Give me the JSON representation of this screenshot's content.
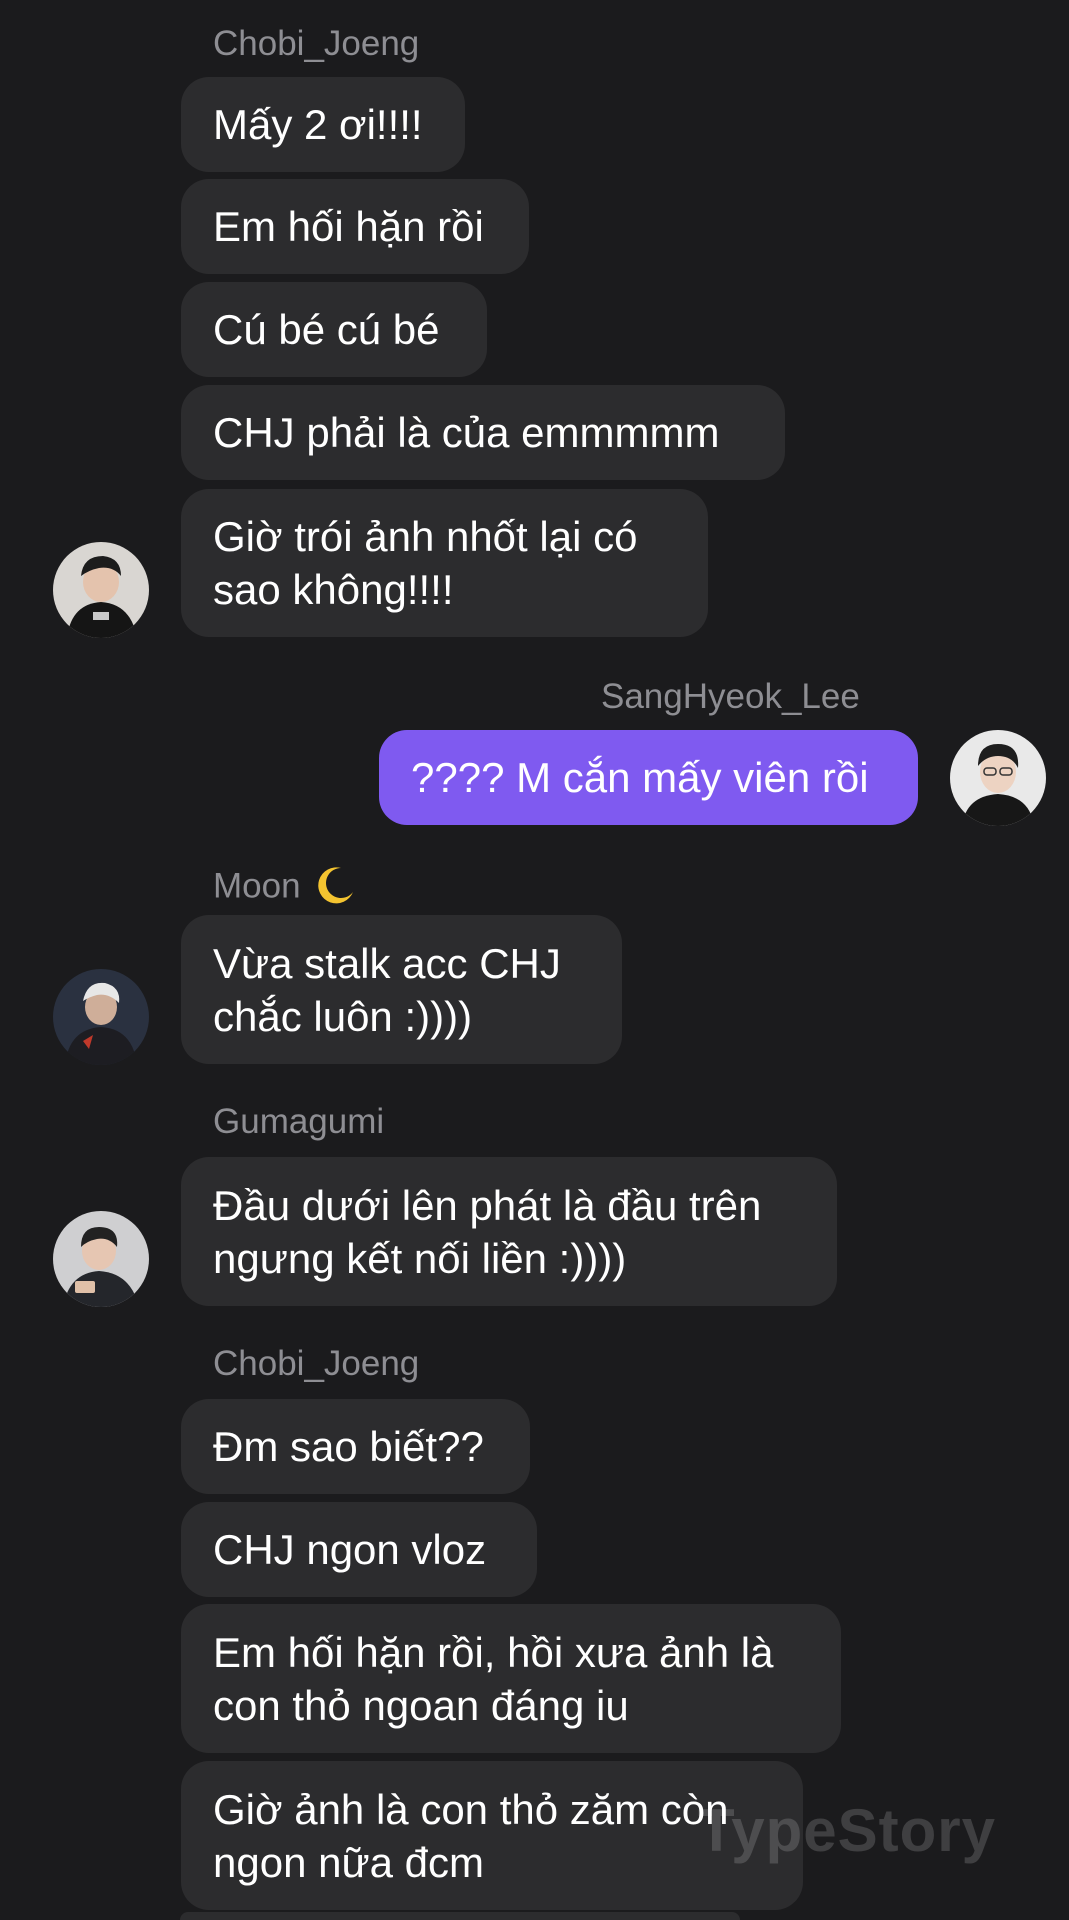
{
  "conversation": {
    "group1": {
      "sender": "Chobi_Joeng",
      "messages": [
        {
          "text": "Mấy 2 ơi!!!!"
        },
        {
          "text": "Em hối hặn rồi"
        },
        {
          "text": "Cú bé cú bé"
        },
        {
          "text": "CHJ phải là của emmmmm"
        },
        {
          "lines": [
            "Giờ trói ảnh nhốt lại có",
            "sao không!!!!"
          ]
        }
      ]
    },
    "group2": {
      "sender": "SangHyeok_Lee",
      "messages": [
        {
          "text": "???? M cắn mấy viên rồi"
        }
      ]
    },
    "group3": {
      "sender": "Moon",
      "sender_emoji_icon": "crescent-moon-icon",
      "messages": [
        {
          "lines": [
            "Vừa stalk acc CHJ",
            "chắc luôn :))))"
          ]
        }
      ]
    },
    "group4": {
      "sender": "Gumagumi",
      "messages": [
        {
          "lines": [
            "Đầu dưới lên phát là đầu trên",
            "ngưng kết nối liền :))))"
          ]
        }
      ]
    },
    "group5": {
      "sender": "Chobi_Joeng",
      "messages": [
        {
          "text": "Đm sao biết??"
        },
        {
          "text": "CHJ ngon vloz"
        },
        {
          "lines": [
            "Em hối hặn rồi, hồi xưa ảnh là",
            "con thỏ ngoan đáng iu"
          ]
        },
        {
          "lines": [
            "Giờ ảnh là con thỏ zăm còn",
            "ngon nữa đcm"
          ]
        }
      ]
    }
  },
  "watermark": "TypeStory",
  "colors": {
    "background": "#1b1b1d",
    "incoming_bubble": "#2c2c2e",
    "outgoing_bubble": "#7f5af0",
    "sender_name": "#8e8e93",
    "text": "#ffffff"
  }
}
